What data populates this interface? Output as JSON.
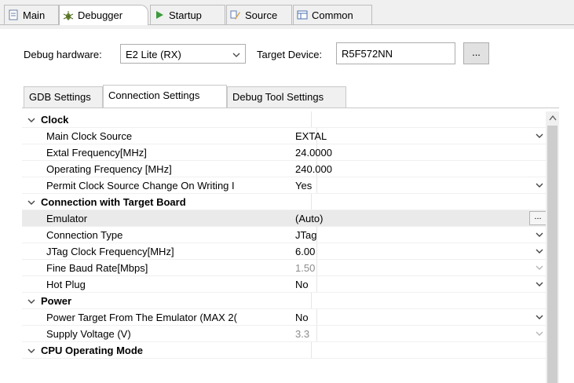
{
  "tabs": [
    {
      "label": "Main",
      "icon": "document-icon",
      "active": false
    },
    {
      "label": "Debugger",
      "icon": "bug-icon",
      "active": true
    },
    {
      "label": "Startup",
      "icon": "play-icon",
      "active": false
    },
    {
      "label": "Source",
      "icon": "source-icon",
      "active": false
    },
    {
      "label": "Common",
      "icon": "common-icon",
      "active": false
    }
  ],
  "header": {
    "debug_hw_label": "Debug hardware:",
    "debug_hw_value": "E2 Lite (RX)",
    "target_label": "Target Device:",
    "target_value": "R5F572NN",
    "browse_label": "..."
  },
  "inner_tabs": [
    {
      "label": "GDB Settings",
      "active": false
    },
    {
      "label": "Connection Settings",
      "active": true
    },
    {
      "label": "Debug Tool Settings",
      "active": false
    }
  ],
  "table": {
    "rows": [
      {
        "type": "group",
        "label": "Clock"
      },
      {
        "type": "prop",
        "label": "Main Clock Source",
        "value": "EXTAL",
        "control": "dropdown"
      },
      {
        "type": "prop",
        "label": "Extal Frequency[MHz]",
        "value": "24.0000",
        "control": "text"
      },
      {
        "type": "prop",
        "label": "Operating Frequency [MHz]",
        "value": "240.000",
        "control": "text"
      },
      {
        "type": "prop",
        "label": "Permit Clock Source Change On Writing I",
        "value": "Yes",
        "control": "dropdown"
      },
      {
        "type": "group",
        "label": "Connection with Target Board"
      },
      {
        "type": "prop",
        "label": "Emulator",
        "value": "(Auto)",
        "control": "browse",
        "selected": true
      },
      {
        "type": "prop",
        "label": "Connection Type",
        "value": "JTag",
        "control": "dropdown"
      },
      {
        "type": "prop",
        "label": "JTag Clock Frequency[MHz]",
        "value": "6.00",
        "control": "dropdown"
      },
      {
        "type": "prop",
        "label": "Fine Baud Rate[Mbps]",
        "value": "1.50",
        "control": "dropdown",
        "disabled": true
      },
      {
        "type": "prop",
        "label": "Hot Plug",
        "value": "No",
        "control": "dropdown"
      },
      {
        "type": "group",
        "label": "Power"
      },
      {
        "type": "prop",
        "label": "Power Target From The Emulator (MAX 2(",
        "value": "No",
        "control": "dropdown"
      },
      {
        "type": "prop",
        "label": "Supply Voltage (V)",
        "value": "3.3",
        "control": "dropdown",
        "disabled": true
      },
      {
        "type": "group",
        "label": "CPU Operating Mode"
      }
    ]
  },
  "colors": {
    "accent": "#0078d7",
    "selected_row": "#eaeaea",
    "disabled_text": "#8c8c8c"
  }
}
